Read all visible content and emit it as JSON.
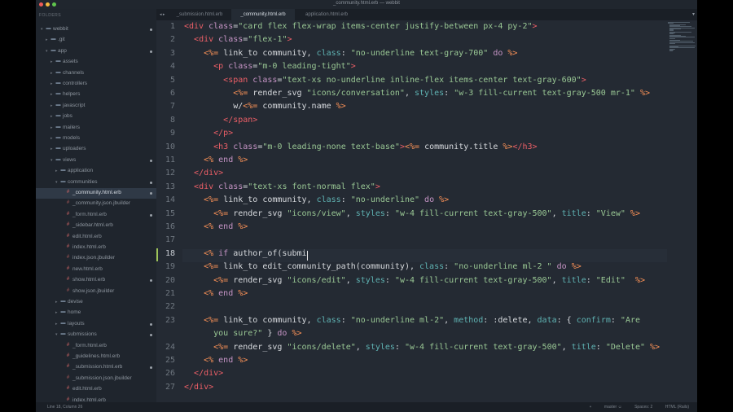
{
  "window": {
    "title": "_community.html.erb — webbit"
  },
  "sidebar": {
    "header": "FOLDERS",
    "items": [
      {
        "label": "webbit",
        "depth": 0,
        "kind": "folder",
        "open": true,
        "dot": true
      },
      {
        "label": ".git",
        "depth": 1,
        "kind": "folder",
        "open": false,
        "dot": false
      },
      {
        "label": "app",
        "depth": 1,
        "kind": "folder",
        "open": true,
        "dot": true
      },
      {
        "label": "assets",
        "depth": 2,
        "kind": "folder",
        "open": false,
        "dot": false
      },
      {
        "label": "channels",
        "depth": 2,
        "kind": "folder",
        "open": false,
        "dot": false
      },
      {
        "label": "controllers",
        "depth": 2,
        "kind": "folder",
        "open": false,
        "dot": false
      },
      {
        "label": "helpers",
        "depth": 2,
        "kind": "folder",
        "open": false,
        "dot": false
      },
      {
        "label": "javascript",
        "depth": 2,
        "kind": "folder",
        "open": false,
        "dot": false
      },
      {
        "label": "jobs",
        "depth": 2,
        "kind": "folder",
        "open": false,
        "dot": false
      },
      {
        "label": "mailers",
        "depth": 2,
        "kind": "folder",
        "open": false,
        "dot": false
      },
      {
        "label": "models",
        "depth": 2,
        "kind": "folder",
        "open": false,
        "dot": false
      },
      {
        "label": "uploaders",
        "depth": 2,
        "kind": "folder",
        "open": false,
        "dot": false
      },
      {
        "label": "views",
        "depth": 2,
        "kind": "folder",
        "open": true,
        "dot": true
      },
      {
        "label": "application",
        "depth": 3,
        "kind": "folder",
        "open": false,
        "dot": false
      },
      {
        "label": "communities",
        "depth": 3,
        "kind": "folder",
        "open": true,
        "dot": true
      },
      {
        "label": "_community.html.erb",
        "depth": 4,
        "kind": "erb",
        "selected": true,
        "dot": true
      },
      {
        "label": "_community.json.jbuilder",
        "depth": 4,
        "kind": "rb",
        "dot": false
      },
      {
        "label": "_form.html.erb",
        "depth": 4,
        "kind": "erb",
        "dot": true
      },
      {
        "label": "_sidebar.html.erb",
        "depth": 4,
        "kind": "erb",
        "dot": false
      },
      {
        "label": "edit.html.erb",
        "depth": 4,
        "kind": "erb",
        "dot": false
      },
      {
        "label": "index.html.erb",
        "depth": 4,
        "kind": "erb",
        "dot": false
      },
      {
        "label": "index.json.jbuilder",
        "depth": 4,
        "kind": "rb",
        "dot": false
      },
      {
        "label": "new.html.erb",
        "depth": 4,
        "kind": "erb",
        "dot": false
      },
      {
        "label": "show.html.erb",
        "depth": 4,
        "kind": "erb",
        "dot": true
      },
      {
        "label": "show.json.jbuilder",
        "depth": 4,
        "kind": "rb",
        "dot": false
      },
      {
        "label": "devise",
        "depth": 3,
        "kind": "folder",
        "open": false,
        "dot": false
      },
      {
        "label": "home",
        "depth": 3,
        "kind": "folder",
        "open": false,
        "dot": false
      },
      {
        "label": "layouts",
        "depth": 3,
        "kind": "folder",
        "open": false,
        "dot": true
      },
      {
        "label": "submissions",
        "depth": 3,
        "kind": "folder",
        "open": true,
        "dot": true
      },
      {
        "label": "_form.html.erb",
        "depth": 4,
        "kind": "erb",
        "dot": false
      },
      {
        "label": "_guidelines.html.erb",
        "depth": 4,
        "kind": "erb",
        "dot": false
      },
      {
        "label": "_submission.html.erb",
        "depth": 4,
        "kind": "erb",
        "dot": true
      },
      {
        "label": "_submission.json.jbuilder",
        "depth": 4,
        "kind": "rb",
        "dot": false
      },
      {
        "label": "edit.html.erb",
        "depth": 4,
        "kind": "erb",
        "dot": false
      },
      {
        "label": "index.html.erb",
        "depth": 4,
        "kind": "erb",
        "dot": false
      }
    ]
  },
  "tabs": [
    {
      "label": "_submission.html.erb",
      "active": false
    },
    {
      "label": "_community.html.erb",
      "active": true
    },
    {
      "label": "application.html.erb",
      "active": false
    }
  ],
  "tab_arrows": "◂ ▸",
  "tab_menu": "▾",
  "editor": {
    "current_line": 18,
    "lines": [
      {
        "n": "1",
        "tokens": [
          [
            "t",
            "<div "
          ],
          [
            "a",
            "class"
          ],
          [
            "n",
            "="
          ],
          [
            "s",
            "\"card flex flex-wrap items-center justify-between px-4 py-2\""
          ],
          [
            "t",
            ">"
          ]
        ]
      },
      {
        "n": "2",
        "tokens": [
          [
            "n",
            "  "
          ],
          [
            "t",
            "<div "
          ],
          [
            "a",
            "class"
          ],
          [
            "n",
            "="
          ],
          [
            "s",
            "\"flex-1\""
          ],
          [
            "t",
            ">"
          ]
        ]
      },
      {
        "n": "3",
        "tokens": [
          [
            "n",
            "    "
          ],
          [
            "e",
            "<%= "
          ],
          [
            "n",
            "link_to community, "
          ],
          [
            "p",
            "class"
          ],
          [
            "n",
            ": "
          ],
          [
            "s",
            "\"no-underline text-gray-700\""
          ],
          [
            "k",
            " do "
          ],
          [
            "e",
            "%>"
          ]
        ]
      },
      {
        "n": "4",
        "tokens": [
          [
            "n",
            "      "
          ],
          [
            "t",
            "<p "
          ],
          [
            "a",
            "class"
          ],
          [
            "n",
            "="
          ],
          [
            "s",
            "\"m-0 leading-tight\""
          ],
          [
            "t",
            ">"
          ]
        ]
      },
      {
        "n": "5",
        "tokens": [
          [
            "n",
            "        "
          ],
          [
            "t",
            "<span "
          ],
          [
            "a",
            "class"
          ],
          [
            "n",
            "="
          ],
          [
            "s",
            "\"text-xs no-underline inline-flex items-center text-gray-600\""
          ],
          [
            "t",
            ">"
          ]
        ]
      },
      {
        "n": "6",
        "tokens": [
          [
            "n",
            "          "
          ],
          [
            "e",
            "<%= "
          ],
          [
            "n",
            "render_svg "
          ],
          [
            "s",
            "\"icons/conversation\""
          ],
          [
            "n",
            ", "
          ],
          [
            "p",
            "styles"
          ],
          [
            "n",
            ": "
          ],
          [
            "s",
            "\"w-3 fill-current text-gray-500 mr-1\""
          ],
          [
            "e",
            " %>"
          ]
        ]
      },
      {
        "n": "7",
        "tokens": [
          [
            "n",
            "          w/"
          ],
          [
            "e",
            "<%= "
          ],
          [
            "n",
            "community.name "
          ],
          [
            "e",
            "%>"
          ]
        ]
      },
      {
        "n": "8",
        "tokens": [
          [
            "n",
            "        "
          ],
          [
            "t",
            "</span>"
          ]
        ]
      },
      {
        "n": "9",
        "tokens": [
          [
            "n",
            "      "
          ],
          [
            "t",
            "</p>"
          ]
        ]
      },
      {
        "n": "10",
        "tokens": [
          [
            "n",
            "      "
          ],
          [
            "t",
            "<h3 "
          ],
          [
            "a",
            "class"
          ],
          [
            "n",
            "="
          ],
          [
            "s",
            "\"m-0 leading-none text-base\""
          ],
          [
            "t",
            ">"
          ],
          [
            "e",
            "<%= "
          ],
          [
            "n",
            "community.title "
          ],
          [
            "e",
            "%>"
          ],
          [
            "t",
            "</h3>"
          ]
        ]
      },
      {
        "n": "11",
        "tokens": [
          [
            "n",
            "    "
          ],
          [
            "e",
            "<% "
          ],
          [
            "k",
            "end "
          ],
          [
            "e",
            "%>"
          ]
        ]
      },
      {
        "n": "12",
        "tokens": [
          [
            "n",
            "  "
          ],
          [
            "t",
            "</div>"
          ]
        ]
      },
      {
        "n": "13",
        "tokens": [
          [
            "n",
            "  "
          ],
          [
            "t",
            "<div "
          ],
          [
            "a",
            "class"
          ],
          [
            "n",
            "="
          ],
          [
            "s",
            "\"text-xs font-normal flex\""
          ],
          [
            "t",
            ">"
          ]
        ]
      },
      {
        "n": "14",
        "tokens": [
          [
            "n",
            "    "
          ],
          [
            "e",
            "<%= "
          ],
          [
            "n",
            "link_to community, "
          ],
          [
            "p",
            "class"
          ],
          [
            "n",
            ": "
          ],
          [
            "s",
            "\"no-underline\""
          ],
          [
            "k",
            " do "
          ],
          [
            "e",
            "%>"
          ]
        ]
      },
      {
        "n": "15",
        "tokens": [
          [
            "n",
            "      "
          ],
          [
            "e",
            "<%= "
          ],
          [
            "n",
            "render_svg "
          ],
          [
            "s",
            "\"icons/view\""
          ],
          [
            "n",
            ", "
          ],
          [
            "p",
            "styles"
          ],
          [
            "n",
            ": "
          ],
          [
            "s",
            "\"w-4 fill-current text-gray-500\""
          ],
          [
            "n",
            ", "
          ],
          [
            "p",
            "title"
          ],
          [
            "n",
            ": "
          ],
          [
            "s",
            "\"View\""
          ],
          [
            "e",
            " %>"
          ]
        ]
      },
      {
        "n": "16",
        "tokens": [
          [
            "n",
            "    "
          ],
          [
            "e",
            "<% "
          ],
          [
            "k",
            "end "
          ],
          [
            "e",
            "%>"
          ]
        ]
      },
      {
        "n": "17",
        "tokens": []
      },
      {
        "n": "18",
        "tokens": [
          [
            "n",
            "    "
          ],
          [
            "e",
            "<% "
          ],
          [
            "k",
            "if "
          ],
          [
            "n",
            "author_of(submi"
          ]
        ]
      },
      {
        "n": "19",
        "tokens": [
          [
            "n",
            "    "
          ],
          [
            "e",
            "<%= "
          ],
          [
            "n",
            "link_to edit_community_path(community), "
          ],
          [
            "p",
            "class"
          ],
          [
            "n",
            ": "
          ],
          [
            "s",
            "\"no-underline ml-2 \""
          ],
          [
            "k",
            " do "
          ],
          [
            "e",
            "%>"
          ]
        ]
      },
      {
        "n": "20",
        "tokens": [
          [
            "n",
            "      "
          ],
          [
            "e",
            "<%= "
          ],
          [
            "n",
            "render_svg "
          ],
          [
            "s",
            "\"icons/edit\""
          ],
          [
            "n",
            ", "
          ],
          [
            "p",
            "styles"
          ],
          [
            "n",
            ": "
          ],
          [
            "s",
            "\"w-4 fill-current text-gray-500\""
          ],
          [
            "n",
            ", "
          ],
          [
            "p",
            "title"
          ],
          [
            "n",
            ": "
          ],
          [
            "s",
            "\"Edit\""
          ],
          [
            "e",
            "  %>"
          ]
        ]
      },
      {
        "n": "21",
        "tokens": [
          [
            "n",
            "    "
          ],
          [
            "e",
            "<% "
          ],
          [
            "k",
            "end "
          ],
          [
            "e",
            "%>"
          ]
        ]
      },
      {
        "n": "22",
        "tokens": []
      },
      {
        "n": "23",
        "tokens": [
          [
            "n",
            "    "
          ],
          [
            "e",
            "<%= "
          ],
          [
            "n",
            "link_to community, "
          ],
          [
            "p",
            "class"
          ],
          [
            "n",
            ": "
          ],
          [
            "s",
            "\"no-underline ml-2\""
          ],
          [
            "n",
            ", "
          ],
          [
            "p",
            "method"
          ],
          [
            "n",
            ": :delete, "
          ],
          [
            "p",
            "data"
          ],
          [
            "n",
            ": { "
          ],
          [
            "p",
            "confirm"
          ],
          [
            "n",
            ": "
          ],
          [
            "s",
            "\"Are"
          ]
        ]
      },
      {
        "n": "",
        "tokens": [
          [
            "s",
            "      you sure?\""
          ],
          [
            "n",
            " } "
          ],
          [
            "k",
            "do "
          ],
          [
            "e",
            "%>"
          ]
        ]
      },
      {
        "n": "24",
        "tokens": [
          [
            "n",
            "      "
          ],
          [
            "e",
            "<%= "
          ],
          [
            "n",
            "render_svg "
          ],
          [
            "s",
            "\"icons/delete\""
          ],
          [
            "n",
            ", "
          ],
          [
            "p",
            "styles"
          ],
          [
            "n",
            ": "
          ],
          [
            "s",
            "\"w-4 fill-current text-gray-500\""
          ],
          [
            "n",
            ", "
          ],
          [
            "p",
            "title"
          ],
          [
            "n",
            ": "
          ],
          [
            "s",
            "\"Delete\""
          ],
          [
            "e",
            " %>"
          ]
        ]
      },
      {
        "n": "25",
        "tokens": [
          [
            "n",
            "    "
          ],
          [
            "e",
            "<% "
          ],
          [
            "k",
            "end "
          ],
          [
            "e",
            "%>"
          ]
        ]
      },
      {
        "n": "26",
        "tokens": [
          [
            "n",
            "  "
          ],
          [
            "t",
            "</div>"
          ]
        ]
      },
      {
        "n": "27",
        "tokens": [
          [
            "t",
            "</div>"
          ]
        ]
      }
    ]
  },
  "status": {
    "position": "Line 18, Column 26",
    "branch": "master",
    "spaces": "Spaces: 2",
    "syntax": "HTML (Rails)"
  }
}
